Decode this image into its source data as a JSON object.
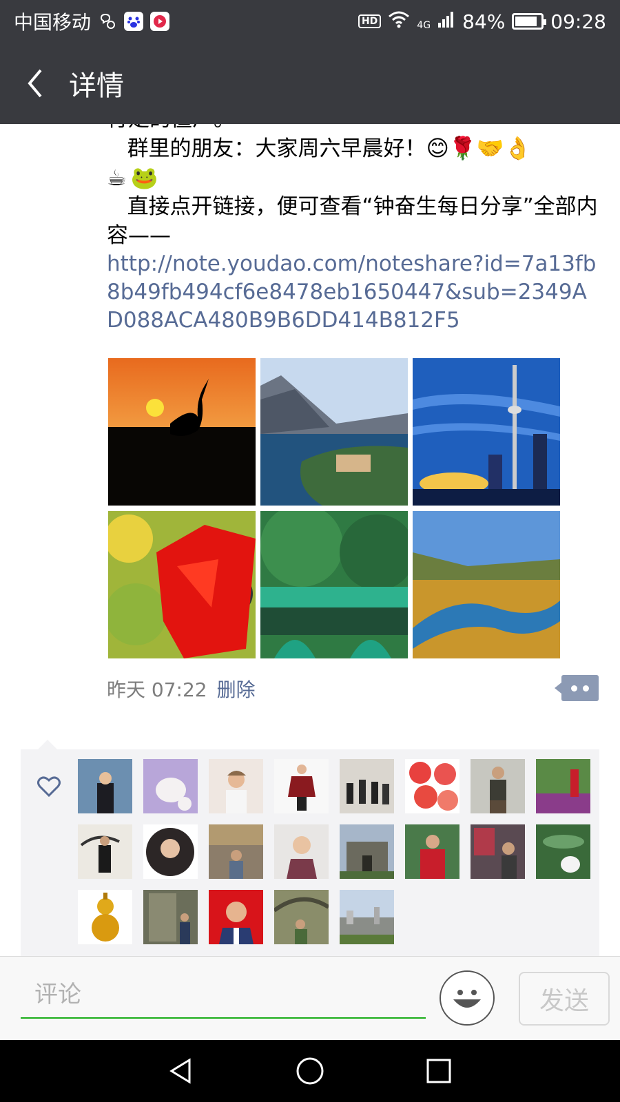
{
  "status_bar": {
    "carrier": "中国移动",
    "network": "4G",
    "hd": "HD",
    "battery": "84%",
    "battery_level": 0.84,
    "time": "09:28",
    "icons": [
      "wechat-notification-icon",
      "baidu-icon",
      "video-app-icon",
      "wifi-icon",
      "signal-icon",
      "battery-icon"
    ]
  },
  "header": {
    "title": "详情",
    "back_icon": "chevron-left-icon"
  },
  "post": {
    "line_cut": "行走的僵尸。",
    "greeting": "   群里的朋友：大家周六早晨好！",
    "greeting_emojis": [
      "😊",
      "🌹",
      "🤝",
      "👌"
    ],
    "second_emojis": [
      "☕",
      "🐸"
    ],
    "instruction": "   直接点开链接，便可查看“钟奋生每日分享”全部内容——",
    "link": "http://note.youdao.com/noteshare?id=7a13fb8b49fb494cf6e8478eb1650447&sub=2349AD088ACA480B9B6DD414B812F5",
    "photos": [
      "crane-sunset-photo",
      "lake-town-photo",
      "cn-tower-photo",
      "red-maple-photo",
      "stone-bridge-photo",
      "river-valley-photo"
    ],
    "time": "昨天 07:22",
    "delete_label": "删除"
  },
  "likes": {
    "icon": "heart-icon",
    "avatars": [
      "avatar-man-office",
      "avatar-white-cat",
      "avatar-woman-cap",
      "avatar-woman-red-shawl",
      "avatar-group-walking",
      "avatar-apples",
      "avatar-man-photographer",
      "avatar-flowers-garden",
      "avatar-man-painting",
      "avatar-woman-portrait",
      "avatar-man-street",
      "avatar-woman-smiling",
      "avatar-old-gate",
      "avatar-woman-red-jacket",
      "avatar-man-temple",
      "avatar-teapot",
      "avatar-gold-gourd",
      "avatar-stone-tablet",
      "avatar-man-red-bg",
      "avatar-man-tree",
      "avatar-city-view"
    ]
  },
  "comment_bar": {
    "placeholder": "评论",
    "send_label": "发送",
    "emoji_icon": "smiley-icon"
  },
  "nav": {
    "back_icon": "nav-back-icon",
    "home_icon": "nav-home-icon",
    "recent_icon": "nav-recent-icon"
  }
}
